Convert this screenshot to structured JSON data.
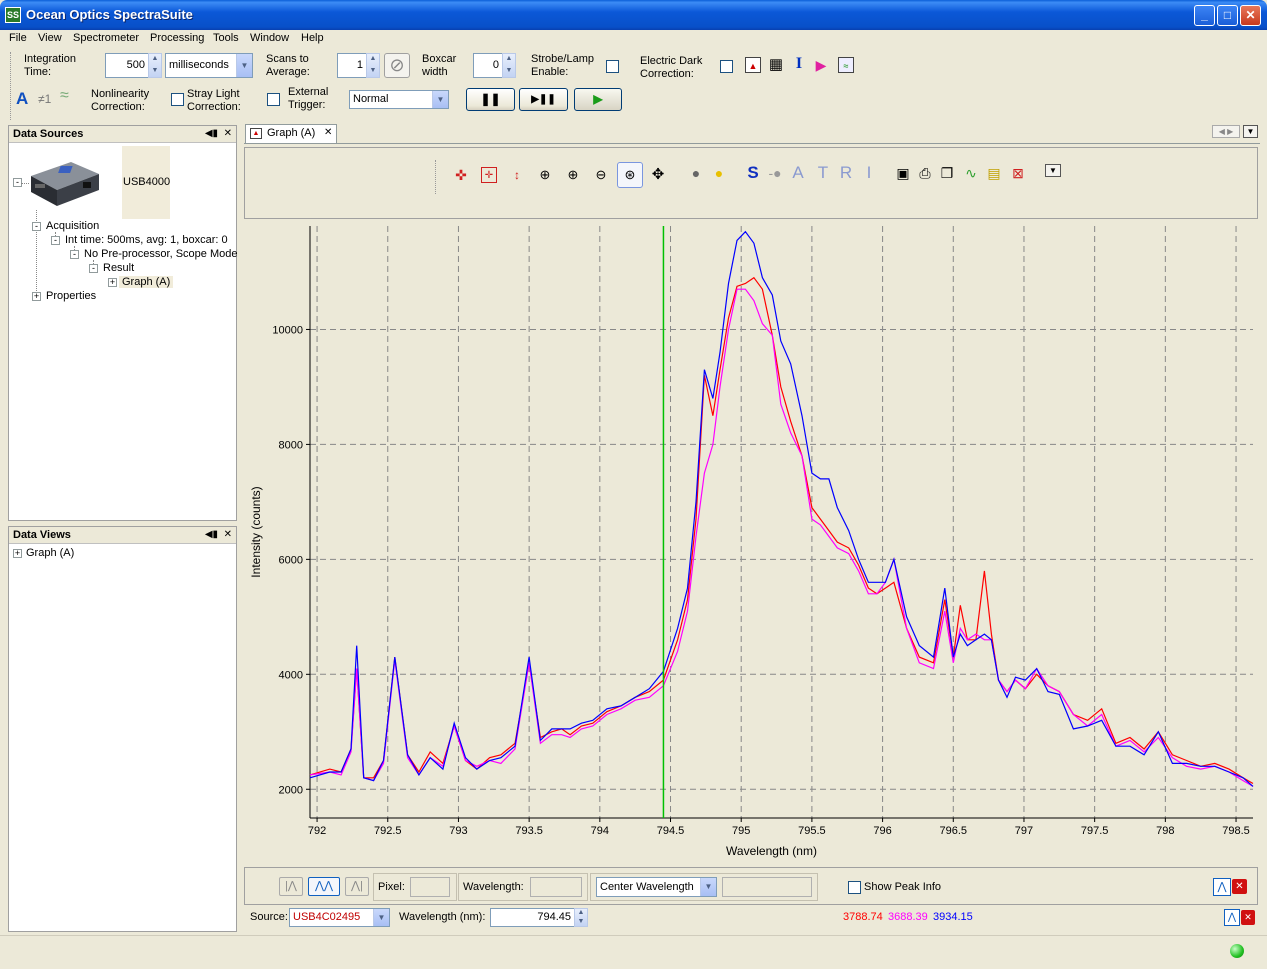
{
  "window": {
    "title": "Ocean Optics SpectraSuite",
    "app_icon": "SS"
  },
  "menu": [
    "File",
    "View",
    "Spectrometer",
    "Processing",
    "Tools",
    "Window",
    "Help"
  ],
  "toolbar": {
    "integration_label1": "Integration",
    "integration_label2": "Time:",
    "integration_value": "500",
    "integration_unit": "milliseconds",
    "scans_label1": "Scans to",
    "scans_label2": "Average:",
    "scans_value": "1",
    "boxcar_label1": "Boxcar",
    "boxcar_label2": "width",
    "boxcar_value": "0",
    "strobe_label1": "Strobe/Lamp",
    "strobe_label2": "Enable:",
    "dark_label1": "Electric Dark",
    "dark_label2": "Correction:",
    "nonlin_label1": "Nonlinearity",
    "nonlin_label2": "Correction:",
    "stray_label1": "Stray Light",
    "stray_label2": "Correction:",
    "ext_label1": "External",
    "ext_label2": "Trigger:",
    "trigger_mode": "Normal",
    "icon_a": "A",
    "icon_neq1": "≠1"
  },
  "data_sources": {
    "title": "Data Sources",
    "device": "USB4000",
    "acquisition": "Acquisition",
    "int_time": "Int time: 500ms, avg: 1, boxcar: 0",
    "preprocessor": "No Pre-processor, Scope Mode",
    "result": "Result",
    "graph": "Graph (A)",
    "properties": "Properties"
  },
  "data_views": {
    "title": "Data Views",
    "graph": "Graph (A)"
  },
  "graph_tab": {
    "label": "Graph (A)"
  },
  "graph_toolbar_letters": {
    "s": "S",
    "a": "A",
    "t": "T",
    "r": "R",
    "i": "I"
  },
  "chart_data": {
    "type": "line",
    "xlabel": "Wavelength (nm)",
    "ylabel": "Intensity (counts)",
    "xlim": [
      791.95,
      798.62
    ],
    "ylim": [
      1500,
      11800
    ],
    "xticks": [
      792,
      792.5,
      793,
      793.5,
      794,
      794.5,
      795,
      795.5,
      796,
      796.5,
      797,
      797.5,
      798,
      798.5
    ],
    "yticks": [
      2000,
      4000,
      6000,
      8000,
      10000
    ],
    "grid": true,
    "cursor_x": 794.45,
    "colors": {
      "red": "#ff0000",
      "magenta": "#ff00ff",
      "blue": "#0000ff",
      "cursor": "#00c000"
    },
    "x": [
      791.95,
      792.09,
      792.17,
      792.24,
      792.28,
      792.33,
      792.4,
      792.47,
      792.55,
      792.64,
      792.72,
      792.8,
      792.89,
      792.97,
      793.05,
      793.13,
      793.22,
      793.3,
      793.4,
      793.5,
      793.58,
      793.66,
      793.73,
      793.79,
      793.87,
      793.95,
      794.05,
      794.15,
      794.25,
      794.35,
      794.45,
      794.55,
      794.62,
      794.68,
      794.74,
      794.8,
      794.85,
      794.91,
      794.97,
      795.03,
      795.09,
      795.15,
      795.22,
      795.28,
      795.35,
      795.43,
      795.5,
      795.56,
      795.62,
      795.68,
      795.76,
      795.83,
      795.9,
      795.96,
      796.02,
      796.08,
      796.17,
      796.26,
      796.36,
      796.44,
      796.5,
      796.55,
      796.6,
      796.66,
      796.72,
      796.77,
      796.82,
      796.88,
      796.94,
      797.01,
      797.09,
      797.17,
      797.25,
      797.35,
      797.45,
      797.55,
      797.65,
      797.75,
      797.85,
      797.95,
      798.05,
      798.15,
      798.25,
      798.35,
      798.45,
      798.55,
      798.62
    ],
    "series": [
      {
        "name": "",
        "color": "#ff0000",
        "values": [
          2250,
          2350,
          2300,
          2700,
          4100,
          2200,
          2200,
          2500,
          4300,
          2600,
          2300,
          2650,
          2450,
          3100,
          2500,
          2350,
          2550,
          2600,
          2800,
          4200,
          2900,
          3000,
          3050,
          2950,
          3100,
          3150,
          3350,
          3450,
          3600,
          3700,
          3900,
          4600,
          5300,
          6700,
          9200,
          8500,
          9300,
          10200,
          10750,
          10800,
          10900,
          10700,
          9900,
          9000,
          8400,
          7800,
          6900,
          6700,
          6500,
          6300,
          6200,
          5900,
          5500,
          5400,
          5500,
          5600,
          4800,
          4300,
          4200,
          5300,
          4300,
          5200,
          4600,
          4600,
          5800,
          4700,
          3900,
          3700,
          3900,
          3750,
          4000,
          3800,
          3700,
          3300,
          3200,
          3400,
          2800,
          2900,
          2700,
          3000,
          2600,
          2500,
          2400,
          2450,
          2350,
          2200,
          2100
        ]
      },
      {
        "name": "",
        "color": "#ff00ff",
        "values": [
          2250,
          2300,
          2250,
          2650,
          4100,
          2200,
          2150,
          2450,
          4250,
          2550,
          2250,
          2550,
          2400,
          3100,
          2500,
          2400,
          2500,
          2450,
          2700,
          4200,
          2800,
          2950,
          2950,
          2900,
          3050,
          3100,
          3300,
          3400,
          3550,
          3600,
          3800,
          4400,
          5100,
          6400,
          7500,
          8000,
          9000,
          10000,
          10700,
          10700,
          10500,
          10100,
          9900,
          8700,
          8200,
          7800,
          6700,
          6600,
          6400,
          6200,
          6100,
          5800,
          5400,
          5400,
          5600,
          6000,
          4800,
          4200,
          4100,
          5100,
          4200,
          4800,
          4600,
          4700,
          4600,
          4600,
          3900,
          3700,
          3900,
          3750,
          4100,
          3800,
          3700,
          3300,
          3100,
          3300,
          2750,
          2850,
          2650,
          2900,
          2550,
          2400,
          2350,
          2400,
          2300,
          2150,
          2050
        ]
      },
      {
        "name": "",
        "color": "#0000ff",
        "values": [
          2200,
          2300,
          2300,
          2700,
          4500,
          2200,
          2150,
          2500,
          4300,
          2600,
          2250,
          2550,
          2350,
          3150,
          2550,
          2350,
          2500,
          2550,
          2750,
          4300,
          2850,
          3050,
          3050,
          3050,
          3150,
          3200,
          3400,
          3450,
          3600,
          3750,
          4050,
          4800,
          5500,
          7000,
          9300,
          8800,
          9600,
          10800,
          11550,
          11700,
          11500,
          10900,
          10600,
          9800,
          9400,
          8500,
          7500,
          7400,
          7400,
          6900,
          6500,
          6000,
          5600,
          5600,
          5600,
          6000,
          5000,
          4500,
          4300,
          5500,
          4300,
          4700,
          4500,
          4600,
          4700,
          4600,
          3900,
          3600,
          3950,
          3900,
          4100,
          3700,
          3650,
          3050,
          3100,
          3200,
          2750,
          2750,
          2600,
          3000,
          2450,
          2450,
          2400,
          2400,
          2300,
          2200,
          2050
        ]
      }
    ]
  },
  "bottom": {
    "pixel_label": "Pixel:",
    "wavelength_label": "Wavelength:",
    "center_mode": "Center Wavelength",
    "show_peak": "Show Peak Info",
    "source_label": "Source:",
    "source_value": "USB4C02495",
    "wl_nm_label": "Wavelength (nm):",
    "wl_nm_value": "794.45",
    "readout_red": "3788.74",
    "readout_magenta": "3688.39",
    "readout_blue": "3934.15",
    "source_color": "#c00000"
  }
}
